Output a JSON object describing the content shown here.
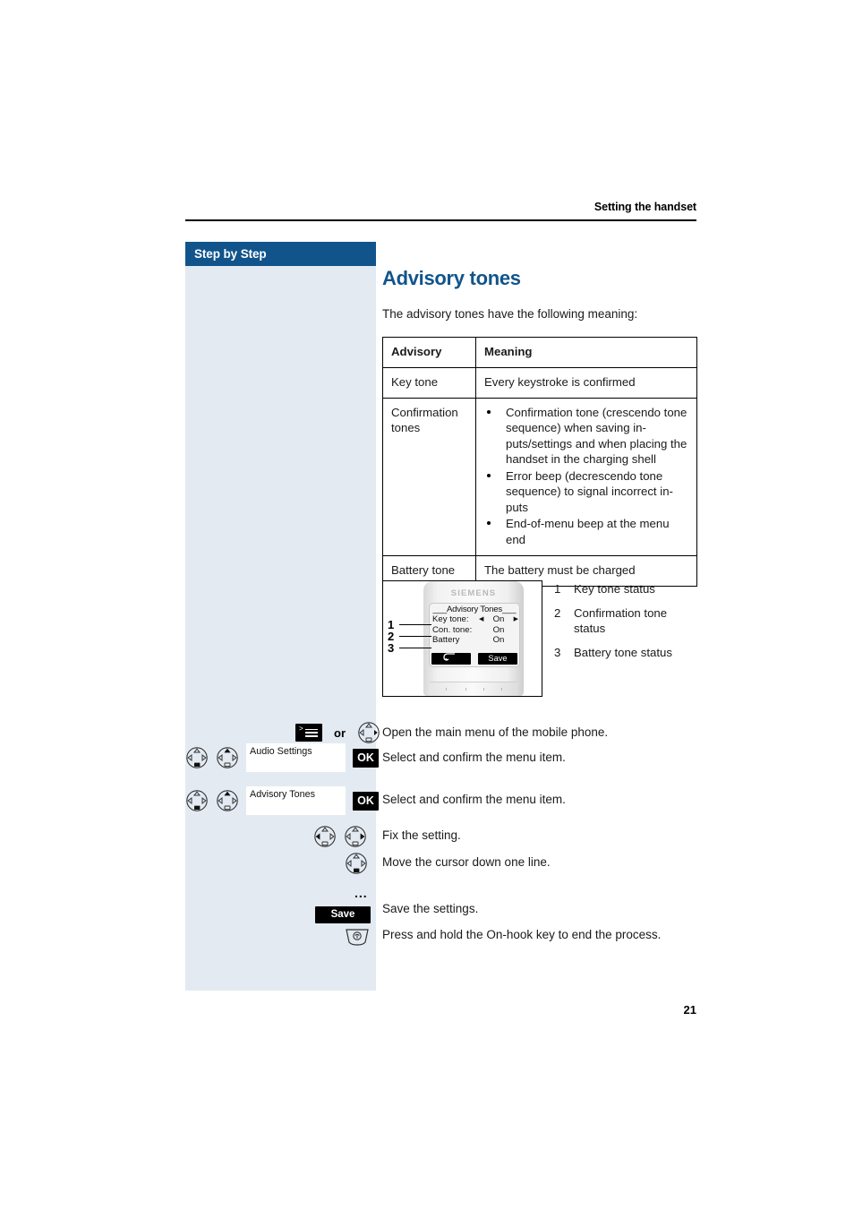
{
  "header": {
    "running_title": "Setting the handset"
  },
  "sidebar": {
    "title": "Step by Step"
  },
  "main": {
    "title": "Advisory tones",
    "intro": "The advisory tones have the following meaning:"
  },
  "table": {
    "columns": [
      "Advisory",
      "Meaning"
    ],
    "rows": [
      {
        "advisory": "Key tone",
        "meaning_text": "Every keystroke is confirmed",
        "meaning_bullets": []
      },
      {
        "advisory": "Confirmation tones",
        "meaning_text": "",
        "meaning_bullets": [
          "Confirmation tone (crescendo tone sequence) when saving in-puts/settings and when placing the handset in the charging shell",
          "Error beep (decrescendo tone sequence) to signal incorrect in-puts",
          "End-of-menu beep at the menu end"
        ]
      },
      {
        "advisory": "Battery tone",
        "meaning_text": "The battery must be charged",
        "meaning_bullets": []
      }
    ]
  },
  "figure": {
    "brand": "SIEMENS",
    "screen_title": "___Advisory Tones___",
    "rows": [
      {
        "label": "Key tone:",
        "value": "On",
        "caret_left": "◀",
        "caret_right": "▶"
      },
      {
        "label": "Con. tone:",
        "value": "On",
        "caret_left": "",
        "caret_right": ""
      },
      {
        "label": "Battery",
        "value": "On",
        "caret_left": "",
        "caret_right": ""
      }
    ],
    "softkey_left": "",
    "softkey_right": "Save",
    "callouts": [
      "1",
      "2",
      "3"
    ],
    "legend": [
      {
        "num": "1",
        "text": "Key tone status"
      },
      {
        "num": "2",
        "text": "Confirmation tone status"
      },
      {
        "num": "3",
        "text": "Battery tone status"
      }
    ]
  },
  "steps": [
    {
      "text": "Open the main menu of the mobile phone.",
      "or_label": "or"
    },
    {
      "field_value": "Audio Settings",
      "ok_label": "OK",
      "text": "Select and confirm the menu item."
    },
    {
      "field_value": "Advisory Tones",
      "ok_label": "OK",
      "text": "Select and confirm the menu item."
    },
    {
      "text": "Fix the setting."
    },
    {
      "text": "Move the cursor down one line."
    },
    {
      "ellipsis": "..."
    },
    {
      "save_label": "Save",
      "text": "Save the settings."
    },
    {
      "text": "Press and hold the On-hook key to end the process."
    }
  ],
  "footer": {
    "page_number": "21"
  },
  "colors": {
    "accent_blue": "#11548b",
    "sidebar_bg": "#e3eaf2",
    "text": "#1a1a1a"
  }
}
